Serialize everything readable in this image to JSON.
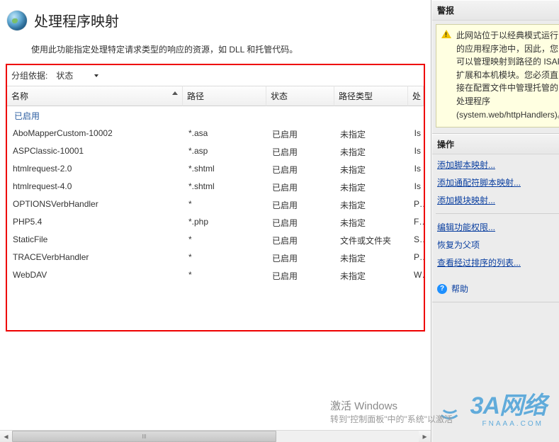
{
  "header": {
    "title": "处理程序映射"
  },
  "description": "使用此功能指定处理特定请求类型的响应的资源，如 DLL 和托管代码。",
  "group_by": {
    "label": "分组依据:",
    "value": "状态"
  },
  "columns": {
    "name": "名称",
    "path": "路径",
    "state": "状态",
    "path_type": "路径类型",
    "handler": "处"
  },
  "group_header": "已启用",
  "rows": [
    {
      "name": "AboMapperCustom-10002",
      "path": "*.asa",
      "state": "已启用",
      "path_type": "未指定",
      "last": "Is"
    },
    {
      "name": "ASPClassic-10001",
      "path": "*.asp",
      "state": "已启用",
      "path_type": "未指定",
      "last": "Is"
    },
    {
      "name": "htmlrequest-2.0",
      "path": "*.shtml",
      "state": "已启用",
      "path_type": "未指定",
      "last": "Is"
    },
    {
      "name": "htmlrequest-4.0",
      "path": "*.shtml",
      "state": "已启用",
      "path_type": "未指定",
      "last": "Is"
    },
    {
      "name": "OPTIONSVerbHandler",
      "path": "*",
      "state": "已启用",
      "path_type": "未指定",
      "last": "Pr"
    },
    {
      "name": "PHP5.4",
      "path": "*.php",
      "state": "已启用",
      "path_type": "未指定",
      "last": "Fa"
    },
    {
      "name": "StaticFile",
      "path": "*",
      "state": "已启用",
      "path_type": "文件或文件夹",
      "last": "St"
    },
    {
      "name": "TRACEVerbHandler",
      "path": "*",
      "state": "已启用",
      "path_type": "未指定",
      "last": "Pr"
    },
    {
      "name": "WebDAV",
      "path": "*",
      "state": "已启用",
      "path_type": "未指定",
      "last": "W"
    }
  ],
  "side": {
    "alerts_title": "警报",
    "alert_text": "此网站位于以经典模式运行的应用程序池中，因此，您可以管理映射到路径的 ISAPI 扩展和本机模块。您必须直接在配置文件中管理托管的处理程序 (system.web/httpHandlers)。",
    "actions_title": "操作",
    "actions": {
      "add_script_map": "添加脚本映射...",
      "add_wildcard": "添加通配符脚本映射...",
      "add_module": "添加模块映射...",
      "edit_perms": "编辑功能权限...",
      "revert_parent": "恢复为父项",
      "view_ordered": "查看经过排序的列表...",
      "help": "帮助"
    }
  },
  "footer": {
    "activate_line1": "激活 Windows",
    "activate_line2": "转到\"控制面板\"中的\"系统\"以激活"
  },
  "logo": {
    "text": "3A网络",
    "sub": "FNAAA.COM"
  }
}
